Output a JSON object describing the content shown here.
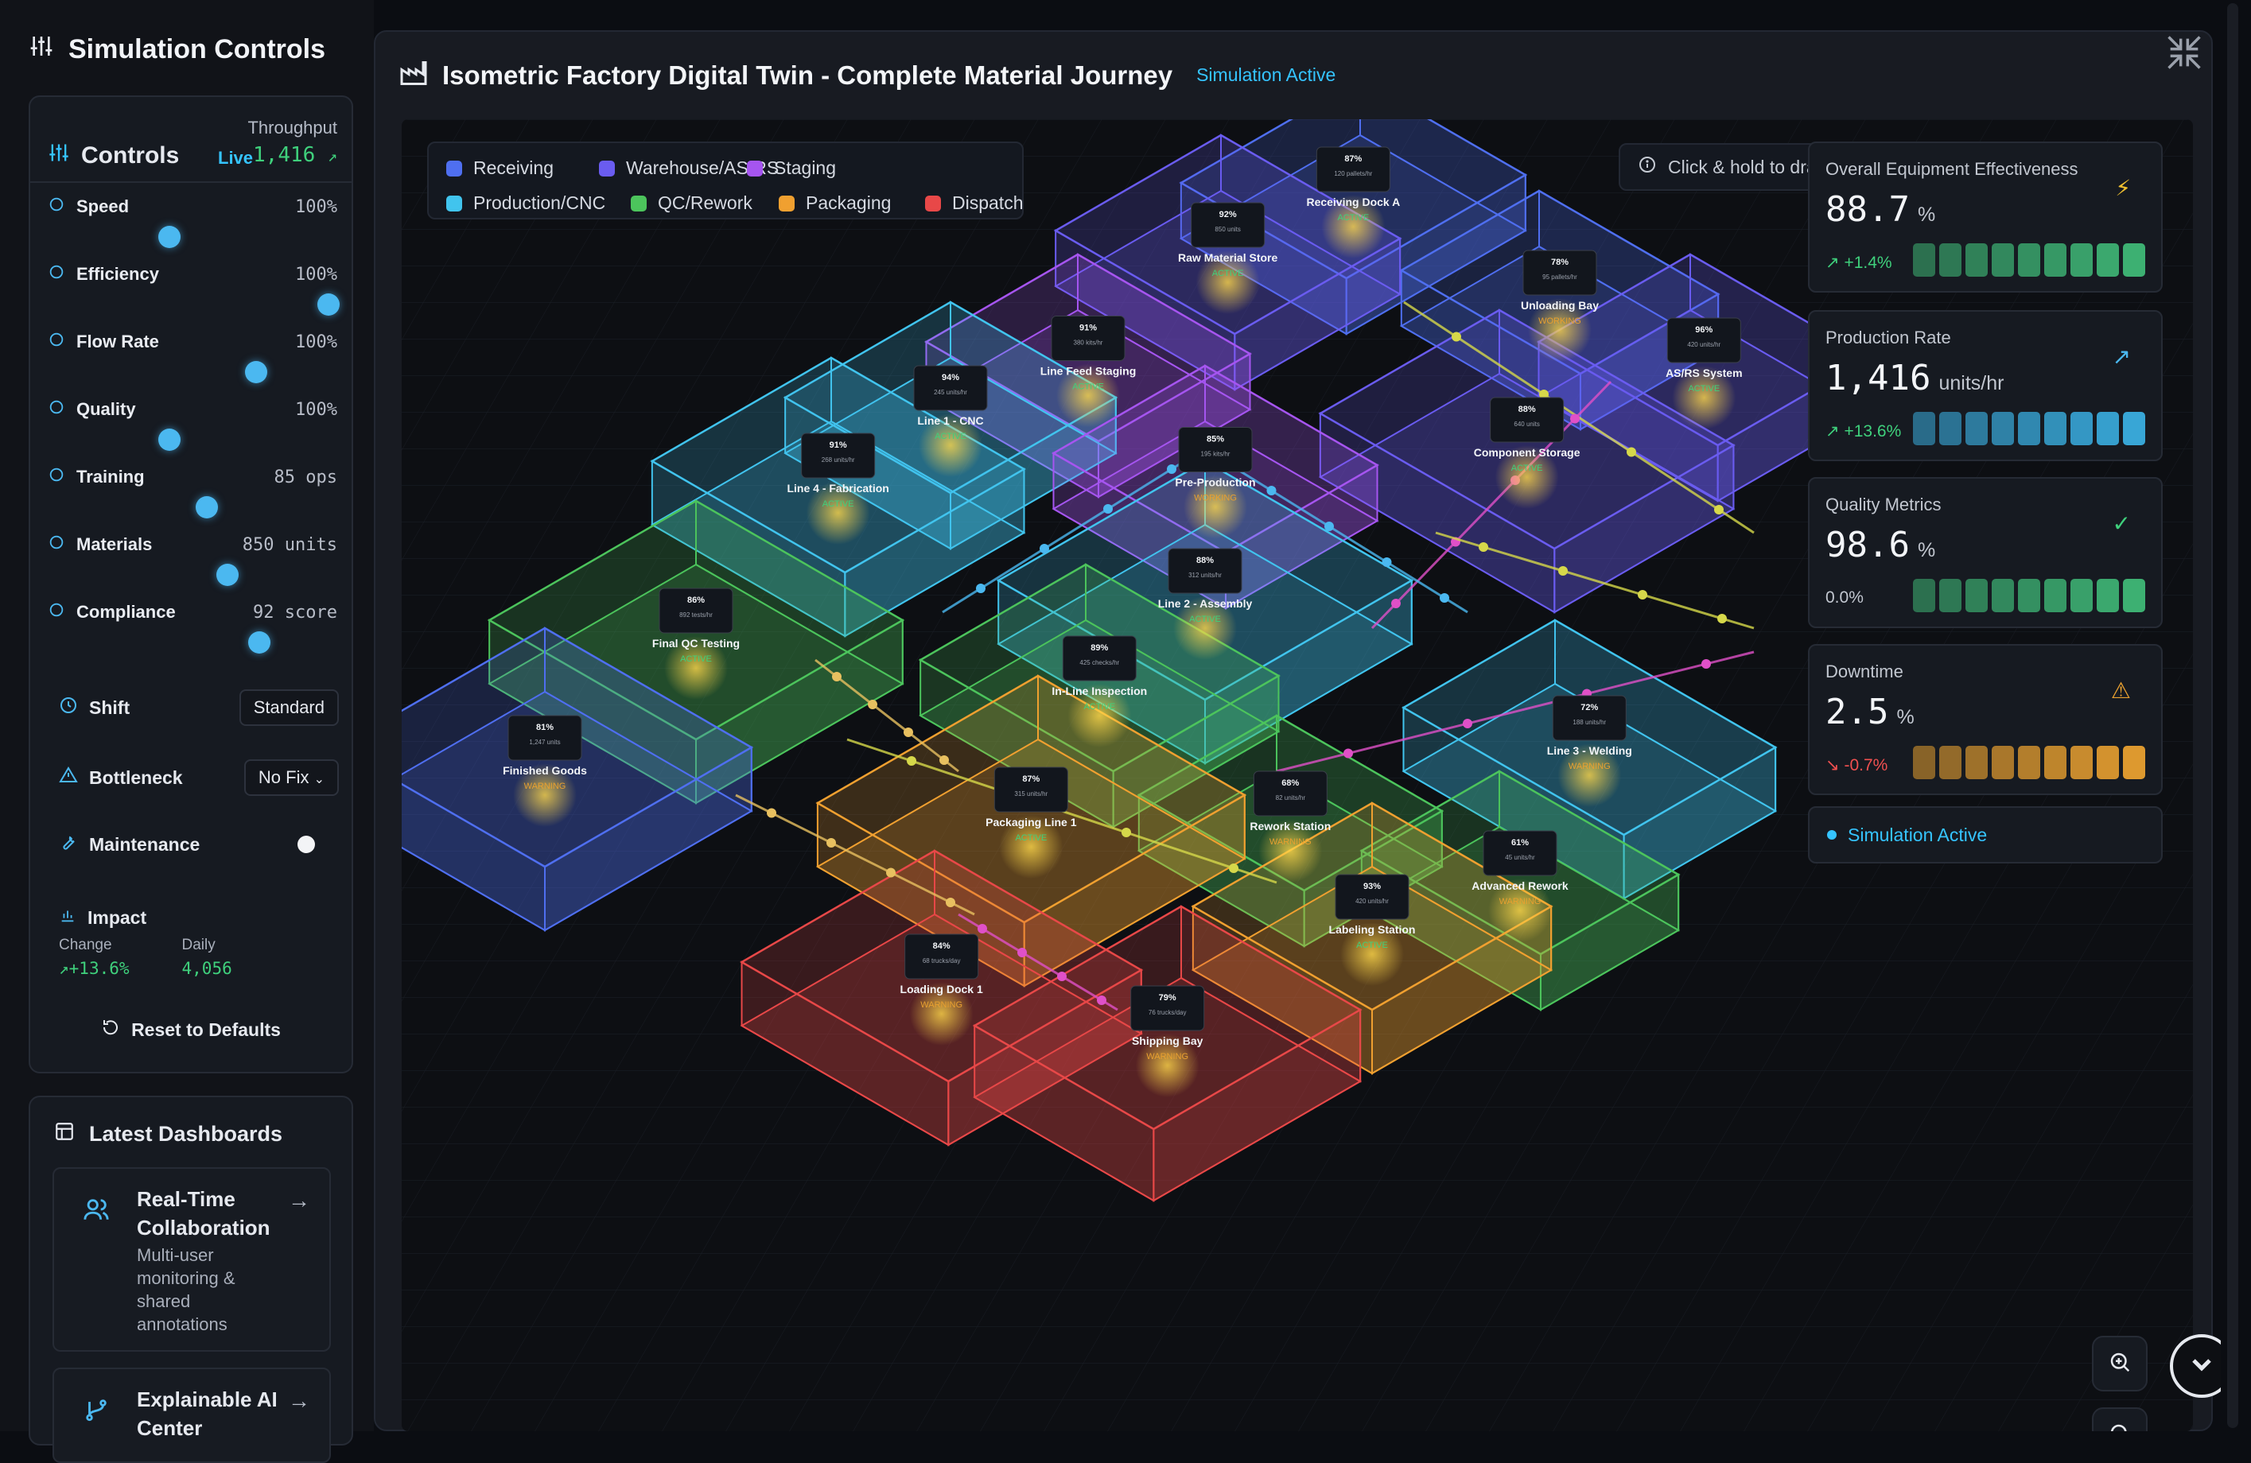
{
  "sidebar": {
    "title": "Simulation Controls",
    "controls": {
      "title": "Controls",
      "live": "Live",
      "throughput_label": "Throughput",
      "throughput_value": "1,416",
      "sliders": [
        {
          "label": "Speed",
          "value": "100%",
          "level": 0.42
        },
        {
          "label": "Efficiency",
          "value": "100%",
          "level": 0.97
        },
        {
          "label": "Flow Rate",
          "value": "100%",
          "level": 0.72
        },
        {
          "label": "Quality",
          "value": "100%",
          "level": 0.42
        },
        {
          "label": "Training",
          "value": "85 ops",
          "level": 0.55
        },
        {
          "label": "Materials",
          "value": "850 units",
          "level": 0.62
        },
        {
          "label": "Compliance",
          "value": "92 score",
          "level": 0.73
        }
      ],
      "shift_label": "Shift",
      "shift_value": "Standard",
      "bottleneck_label": "Bottleneck",
      "bottleneck_value": "No Fix",
      "maintenance_label": "Maintenance",
      "impact_title": "Impact",
      "impact_change_label": "Change",
      "impact_change_value": "+13.6%",
      "impact_daily_label": "Daily",
      "impact_daily_value": "4,056",
      "reset_label": "Reset to Defaults"
    },
    "dashboards": {
      "title": "Latest Dashboards",
      "items": [
        {
          "title": "Real-Time Collaboration",
          "desc": "Multi-user monitoring & shared annotations"
        },
        {
          "title": "Explainable AI Center",
          "desc": ""
        }
      ]
    }
  },
  "main": {
    "title": "Isometric Factory Digital Twin - Complete Material Journey",
    "status": "Simulation Active",
    "hint": "Click & hold to drag",
    "legend": [
      {
        "label": "Receiving",
        "color": "#4f6ff0"
      },
      {
        "label": "Warehouse/AS/RS",
        "color": "#6a5cf0"
      },
      {
        "label": "Staging",
        "color": "#a655f0"
      },
      {
        "label": "Production/CNC",
        "color": "#41c4ee"
      },
      {
        "label": "QC/Rework",
        "color": "#4cc45c"
      },
      {
        "label": "Packaging",
        "color": "#f0a030"
      },
      {
        "label": "Dispatch",
        "color": "#e84848"
      }
    ],
    "kpis": {
      "oee": {
        "label": "Overall Equipment Effectiveness",
        "value": "88.7",
        "unit": "%",
        "change": "+1.4%",
        "color": "#3fb877"
      },
      "rate": {
        "label": "Production Rate",
        "value": "1,416",
        "unit": "units/hr",
        "change": "+13.6%",
        "color": "#3aaee0"
      },
      "quality": {
        "label": "Quality Metrics",
        "value": "98.6",
        "unit": "%",
        "change": "0.0%",
        "color": "#3fb877"
      },
      "downtime": {
        "label": "Downtime",
        "value": "2.5",
        "unit": "%",
        "change": "-0.7%",
        "color": "#e8a030"
      }
    },
    "sim_status": "Simulation Active",
    "zones": [
      {
        "name": "Receiving Dock A",
        "util": "87%",
        "sub": "120 pallets/hr",
        "state": "ACTIVE"
      },
      {
        "name": "Unloading Bay",
        "util": "78%",
        "sub": "95 pallets/hr",
        "state": "WORKING"
      },
      {
        "name": "Raw Material Store",
        "util": "92%",
        "sub": "850 units",
        "state": "ACTIVE"
      },
      {
        "name": "AS/RS System",
        "util": "96%",
        "sub": "420 units/hr",
        "state": "ACTIVE"
      },
      {
        "name": "Line Feed Staging",
        "util": "91%",
        "sub": "380 kits/hr",
        "state": "ACTIVE"
      },
      {
        "name": "Component Storage",
        "util": "88%",
        "sub": "640 units",
        "state": "ACTIVE"
      },
      {
        "name": "Line 1 - CNC",
        "util": "94%",
        "sub": "245 units/hr",
        "state": "ACTIVE"
      },
      {
        "name": "Pre-Production",
        "util": "85%",
        "sub": "195 kits/hr",
        "state": "WORKING"
      },
      {
        "name": "Line 4 - Fabrication",
        "util": "91%",
        "sub": "268 units/hr",
        "state": "ACTIVE"
      },
      {
        "name": "Line 2 - Assembly",
        "util": "88%",
        "sub": "312 units/hr",
        "state": "ACTIVE"
      },
      {
        "name": "Final QC Testing",
        "util": "86%",
        "sub": "892 tests/hr",
        "state": "ACTIVE"
      },
      {
        "name": "In-Line Inspection",
        "util": "89%",
        "sub": "425 checks/hr",
        "state": "ACTIVE"
      },
      {
        "name": "Finished Goods",
        "util": "81%",
        "sub": "1,247 units",
        "state": "WARNING"
      },
      {
        "name": "Rework Station",
        "util": "68%",
        "sub": "82 units/hr",
        "state": "WARNING"
      },
      {
        "name": "Line 3 - Welding",
        "util": "72%",
        "sub": "188 units/hr",
        "state": "WARNING"
      },
      {
        "name": "Packaging Line 1",
        "util": "87%",
        "sub": "315 units/hr",
        "state": "ACTIVE"
      },
      {
        "name": "Advanced Rework",
        "util": "61%",
        "sub": "45 units/hr",
        "state": "WARNING"
      },
      {
        "name": "Loading Dock 1",
        "util": "84%",
        "sub": "68 trucks/day",
        "state": "WARNING"
      },
      {
        "name": "Labeling Station",
        "util": "93%",
        "sub": "420 units/hr",
        "state": "ACTIVE"
      },
      {
        "name": "Shipping Bay",
        "util": "79%",
        "sub": "76 trucks/day",
        "state": "WARNING"
      }
    ]
  }
}
